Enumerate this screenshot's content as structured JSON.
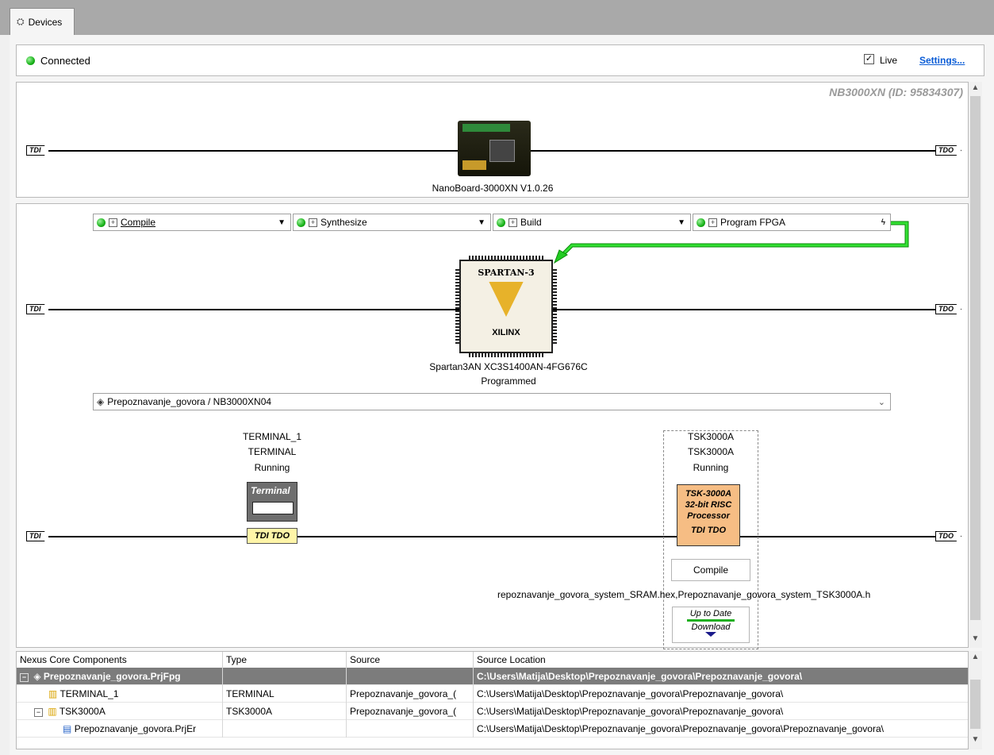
{
  "tab": {
    "label": "Devices"
  },
  "status": {
    "connected_label": "Connected",
    "live_label": "Live",
    "live_checked": "✓",
    "settings_label": "Settings..."
  },
  "board": {
    "id_label": "NB3000XN (ID: 95834307)",
    "name_label": "NanoBoard-3000XN  V1.0.26",
    "tdi": "TDI",
    "tdo": "TDO"
  },
  "flow": {
    "compile": "Compile",
    "synthesize": "Synthesize",
    "build": "Build",
    "program": "Program FPGA"
  },
  "fpga": {
    "chip_brand": "SPARTAN-3",
    "chip_vendor": "XILINX",
    "part_label": "Spartan3AN XC3S1400AN-4FG676C",
    "state_label": "Programmed",
    "tdi": "TDI",
    "tdo": "TDO"
  },
  "project_select": {
    "value": "Prepoznavanje_govora / NB3000XN04"
  },
  "terminal": {
    "name": "TERMINAL_1",
    "type": "TERMINAL",
    "state": "Running",
    "badge": "Terminal",
    "jtag": "TDI  TDO"
  },
  "tsk": {
    "name": "TSK3000A",
    "type": "TSK3000A",
    "state": "Running",
    "line1": "TSK-3000A",
    "line2": "32-bit RISC",
    "line3": "Processor",
    "jtag": "TDI  TDO",
    "compile_button": "Compile",
    "files": "repoznavanje_govora_system_SRAM.hex,Prepoznavanje_govora_system_TSK3000A.h",
    "uptodate": "Up to Date",
    "download": "Download"
  },
  "chain": {
    "tdi": "TDI",
    "tdo": "TDO"
  },
  "grid": {
    "headers": [
      "Nexus Core Components",
      "Type",
      "Source",
      "Source Location"
    ],
    "rows": [
      {
        "name": "Prepoznavanje_govora.PrjFpg",
        "type": "",
        "source": "",
        "location": "C:\\Users\\Matija\\Desktop\\Prepoznavanje_govora\\Prepoznavanje_govora\\"
      },
      {
        "name": "TERMINAL_1",
        "type": "TERMINAL",
        "source": "Prepoznavanje_govora_(",
        "location": "C:\\Users\\Matija\\Desktop\\Prepoznavanje_govora\\Prepoznavanje_govora\\"
      },
      {
        "name": "TSK3000A",
        "type": "TSK3000A",
        "source": "Prepoznavanje_govora_(",
        "location": "C:\\Users\\Matija\\Desktop\\Prepoznavanje_govora\\Prepoznavanje_govora\\"
      },
      {
        "name": "Prepoznavanje_govora.PrjEr",
        "type": "",
        "source": "",
        "location": "C:\\Users\\Matija\\Desktop\\Prepoznavanje_govora\\Prepoznavanje_govora\\Prepoznavanje_govora\\"
      }
    ]
  },
  "colors": {
    "led": "#19b219",
    "link": "#0a5cd6",
    "arrow": "#22cc22",
    "tsk_fill": "#f6bd84",
    "jtag_fill": "#fff5a8",
    "row_selected": "#7c7c7c"
  }
}
